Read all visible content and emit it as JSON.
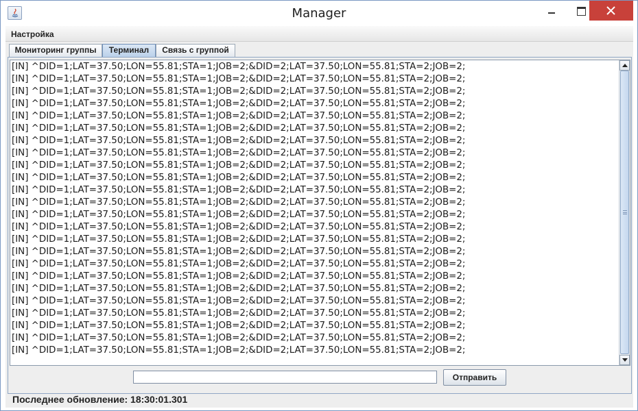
{
  "window": {
    "title": "Manager",
    "accent_close": "#c8413a"
  },
  "menu": {
    "items": [
      "Настройка"
    ]
  },
  "tabs": [
    {
      "label": "Мониторинг группы",
      "active": false
    },
    {
      "label": "Терминал",
      "active": true
    },
    {
      "label": "Связь с группой",
      "active": false
    }
  ],
  "terminal": {
    "lines": [
      "[IN] ^DID=1;LAT=37.50;LON=55.81;STA=1;JOB=2;&DID=2;LAT=37.50;LON=55.81;STA=2;JOB=2;",
      "[IN] ^DID=1;LAT=37.50;LON=55.81;STA=1;JOB=2;&DID=2;LAT=37.50;LON=55.81;STA=2;JOB=2;",
      "[IN] ^DID=1;LAT=37.50;LON=55.81;STA=1;JOB=2;&DID=2;LAT=37.50;LON=55.81;STA=2;JOB=2;",
      "[IN] ^DID=1;LAT=37.50;LON=55.81;STA=1;JOB=2;&DID=2;LAT=37.50;LON=55.81;STA=2;JOB=2;",
      "[IN] ^DID=1;LAT=37.50;LON=55.81;STA=1;JOB=2;&DID=2;LAT=37.50;LON=55.81;STA=2;JOB=2;",
      "[IN] ^DID=1;LAT=37.50;LON=55.81;STA=1;JOB=2;&DID=2;LAT=37.50;LON=55.81;STA=2;JOB=2;",
      "[IN] ^DID=1;LAT=37.50;LON=55.81;STA=1;JOB=2;&DID=2;LAT=37.50;LON=55.81;STA=2;JOB=2;",
      "[IN] ^DID=1;LAT=37.50;LON=55.81;STA=1;JOB=2;&DID=2;LAT=37.50;LON=55.81;STA=2;JOB=2;",
      "[IN] ^DID=1;LAT=37.50;LON=55.81;STA=1;JOB=2;&DID=2;LAT=37.50;LON=55.81;STA=2;JOB=2;",
      "[IN] ^DID=1;LAT=37.50;LON=55.81;STA=1;JOB=2;&DID=2;LAT=37.50;LON=55.81;STA=2;JOB=2;",
      "[IN] ^DID=1;LAT=37.50;LON=55.81;STA=1;JOB=2;&DID=2;LAT=37.50;LON=55.81;STA=2;JOB=2;",
      "[IN] ^DID=1;LAT=37.50;LON=55.81;STA=1;JOB=2;&DID=2;LAT=37.50;LON=55.81;STA=2;JOB=2;",
      "[IN] ^DID=1;LAT=37.50;LON=55.81;STA=1;JOB=2;&DID=2;LAT=37.50;LON=55.81;STA=2;JOB=2;",
      "[IN] ^DID=1;LAT=37.50;LON=55.81;STA=1;JOB=2;&DID=2;LAT=37.50;LON=55.81;STA=2;JOB=2;",
      "[IN] ^DID=1;LAT=37.50;LON=55.81;STA=1;JOB=2;&DID=2;LAT=37.50;LON=55.81;STA=2;JOB=2;",
      "[IN] ^DID=1;LAT=37.50;LON=55.81;STA=1;JOB=2;&DID=2;LAT=37.50;LON=55.81;STA=2;JOB=2;",
      "[IN] ^DID=1;LAT=37.50;LON=55.81;STA=1;JOB=2;&DID=2;LAT=37.50;LON=55.81;STA=2;JOB=2;",
      "[IN] ^DID=1;LAT=37.50;LON=55.81;STA=1;JOB=2;&DID=2;LAT=37.50;LON=55.81;STA=2;JOB=2;",
      "[IN] ^DID=1;LAT=37.50;LON=55.81;STA=1;JOB=2;&DID=2;LAT=37.50;LON=55.81;STA=2;JOB=2;",
      "[IN] ^DID=1;LAT=37.50;LON=55.81;STA=1;JOB=2;&DID=2;LAT=37.50;LON=55.81;STA=2;JOB=2;",
      "[IN] ^DID=1;LAT=37.50;LON=55.81;STA=1;JOB=2;&DID=2;LAT=37.50;LON=55.81;STA=2;JOB=2;",
      "[IN] ^DID=1;LAT=37.50;LON=55.81;STA=1;JOB=2;&DID=2;LAT=37.50;LON=55.81;STA=2;JOB=2;",
      "[IN] ^DID=1;LAT=37.50;LON=55.81;STA=1;JOB=2;&DID=2;LAT=37.50;LON=55.81;STA=2;JOB=2;",
      "[IN] ^DID=1;LAT=37.50;LON=55.81;STA=1;JOB=2;&DID=2;LAT=37.50;LON=55.81;STA=2;JOB=2;"
    ]
  },
  "send": {
    "input_value": "",
    "button_label": "Отправить"
  },
  "status": {
    "text": "Последнее обновление: 18:30:01.301"
  }
}
